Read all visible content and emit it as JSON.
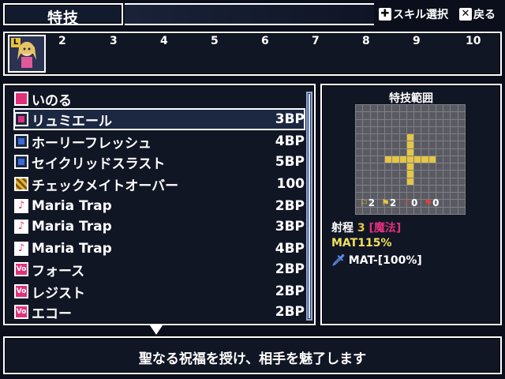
{
  "header": {
    "title": "特技",
    "skill_select_label": "スキル選択",
    "back_label": "戻る",
    "dpad_icon": "dpad-icon",
    "x_button_icon": "x-button-icon"
  },
  "party": {
    "leader_tag": "L",
    "slots": [
      "2",
      "3",
      "4",
      "5",
      "6",
      "7",
      "8",
      "9",
      "10"
    ]
  },
  "skills": [
    {
      "name": "いのる",
      "cost": "",
      "icon": "pink-pray-icon",
      "color": "#e0307a"
    },
    {
      "name": "リュミエール",
      "cost": "3BP",
      "icon": "light-magic-icon",
      "color": "#e0307a",
      "selected": true
    },
    {
      "name": "ホーリーフレッシュ",
      "cost": "4BP",
      "icon": "light-magic-icon",
      "color": "#3a6ad8"
    },
    {
      "name": "セイクリッドスラスト",
      "cost": "5BP",
      "icon": "light-magic-icon",
      "color": "#3a6ad8"
    },
    {
      "name": "チェックメイトオーバー",
      "cost": "100",
      "icon": "checker-icon",
      "color": "#e6b23a"
    },
    {
      "name": "Maria Trap",
      "cost": "2BP",
      "icon": "music-note-icon",
      "color": "#e0307a"
    },
    {
      "name": "Maria Trap",
      "cost": "3BP",
      "icon": "music-note-plus-icon",
      "color": "#e0307a"
    },
    {
      "name": "Maria Trap",
      "cost": "4BP",
      "icon": "music-note-plus2-icon",
      "color": "#e0307a"
    },
    {
      "name": "フォース",
      "cost": "2BP",
      "icon": "vo-icon",
      "color": "#e0307a"
    },
    {
      "name": "レジスト",
      "cost": "2BP",
      "icon": "vo-icon",
      "color": "#e0307a"
    },
    {
      "name": "エコー",
      "cost": "2BP",
      "icon": "vo-icon",
      "color": "#e0307a"
    }
  ],
  "range": {
    "title": "特技範囲",
    "stats": [
      "2",
      "2",
      "0",
      "0"
    ],
    "range_label": "射程",
    "range_value": "3",
    "range_type": "[魔法]",
    "mat_label": "MAT115%",
    "effect_label": "MAT-[100%]",
    "hit_color": "#e6c642"
  },
  "description": "聖なる祝福を授け、相手を魅了します"
}
